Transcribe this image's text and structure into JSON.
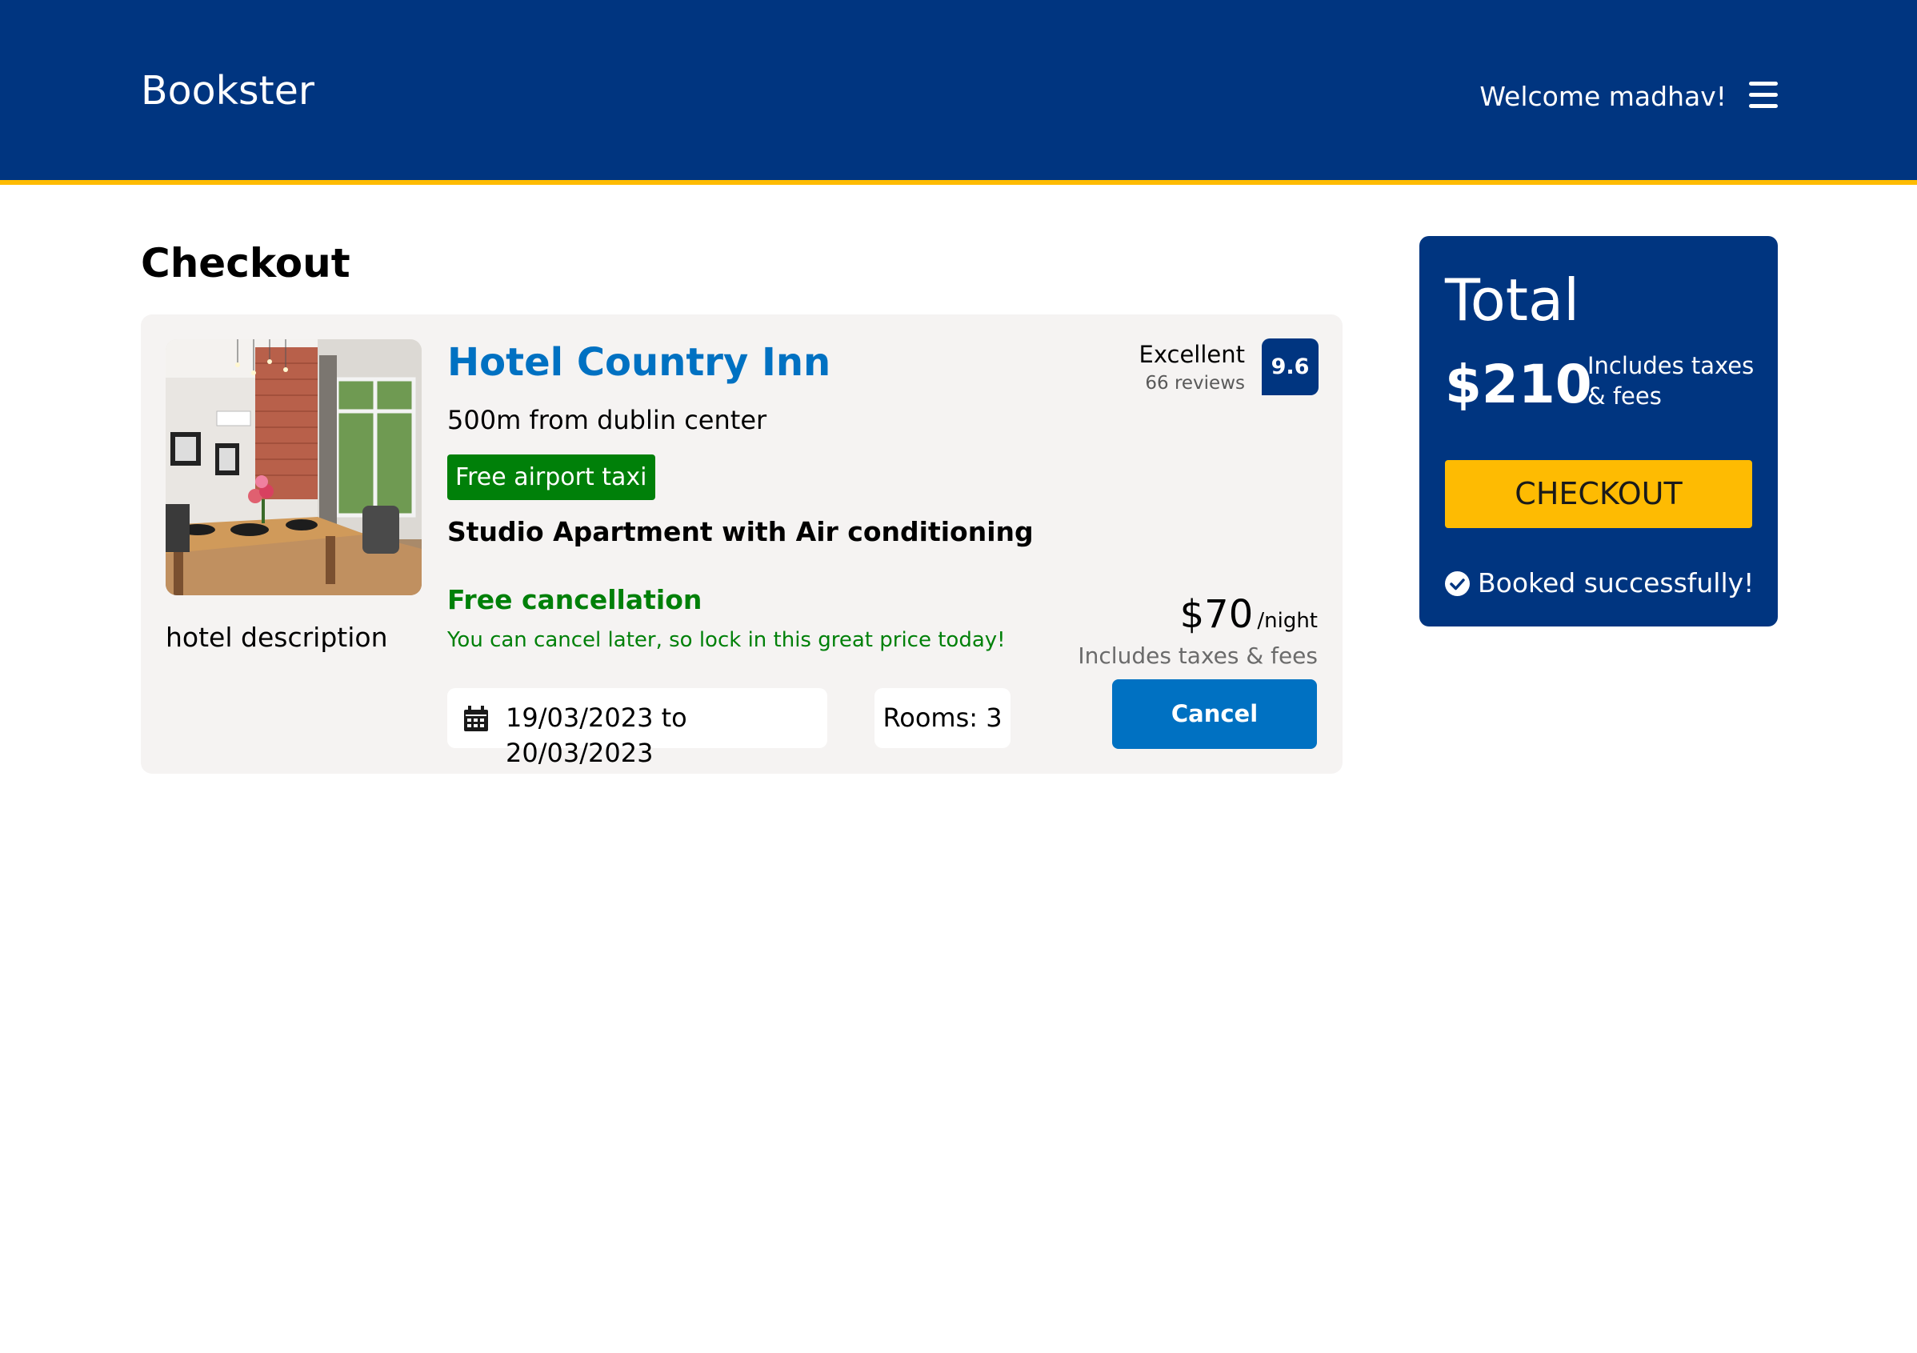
{
  "header": {
    "brand": "Bookster",
    "welcome": "Welcome madhav!",
    "menu_icon": "hamburger-menu-icon"
  },
  "page_title": "Checkout",
  "booking": {
    "image_icon": "hotel-room-photo",
    "image_caption": "hotel description",
    "hotel_name": "Hotel Country Inn",
    "distance": "500m from dublin center",
    "taxi_badge": "Free airport taxi",
    "room_type": "Studio Apartment with Air conditioning",
    "cancellation_title": "Free cancellation",
    "cancellation_note": "You can cancel later, so lock in this great price today!",
    "dates": "19/03/2023 to 20/03/2023",
    "calendar_icon": "calendar-icon",
    "rooms": "Rooms: 3",
    "rating_word": "Excellent",
    "review_count": "66 reviews",
    "score": "9.6",
    "price": "$70",
    "price_unit": "/night",
    "price_taxes": "Includes taxes & fees",
    "cancel_label": "Cancel"
  },
  "summary": {
    "title": "Total",
    "amount": "$210",
    "note": "Includes taxes & fees",
    "checkout_label": "CHECKOUT",
    "status_icon": "check-circle-icon",
    "status_text": "Booked successfully!"
  },
  "colors": {
    "brand_blue": "#003580",
    "accent_yellow": "#febb02",
    "link_blue": "#0071c2",
    "success_green": "#008009",
    "card_bg": "#f5f3f2"
  }
}
